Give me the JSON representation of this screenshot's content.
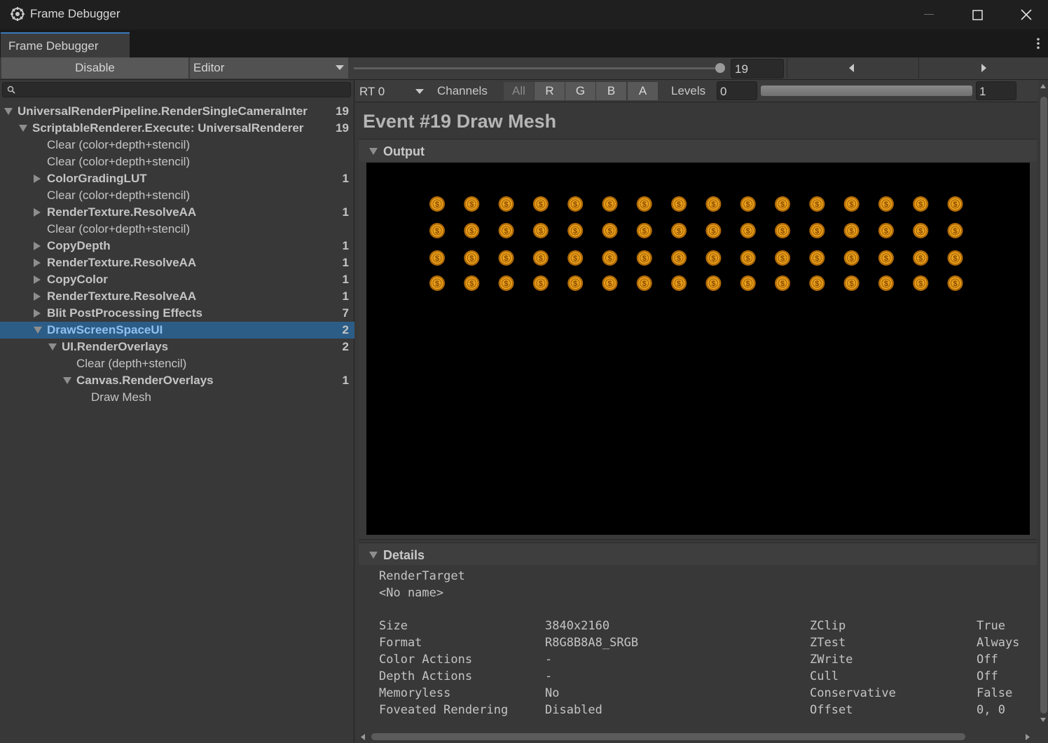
{
  "window": {
    "title": "Frame Debugger"
  },
  "tab": {
    "label": "Frame Debugger"
  },
  "toolbar": {
    "disable_label": "Disable",
    "target_label": "Editor",
    "event_index": "19",
    "event_slider_fraction": 1.0
  },
  "tree": {
    "rows": [
      {
        "label": "UniversalRenderPipeline.RenderSingleCameraInter",
        "count": "19",
        "depth": 0,
        "expand": "down",
        "bold": true
      },
      {
        "label": "ScriptableRenderer.Execute: UniversalRenderer",
        "count": "19",
        "depth": 1,
        "expand": "down",
        "bold": true
      },
      {
        "label": "Clear (color+depth+stencil)",
        "count": "",
        "depth": 2,
        "expand": "none",
        "bold": false
      },
      {
        "label": "Clear (color+depth+stencil)",
        "count": "",
        "depth": 2,
        "expand": "none",
        "bold": false
      },
      {
        "label": "ColorGradingLUT",
        "count": "1",
        "depth": 2,
        "expand": "right",
        "bold": true
      },
      {
        "label": "Clear (color+depth+stencil)",
        "count": "",
        "depth": 2,
        "expand": "none",
        "bold": false
      },
      {
        "label": "RenderTexture.ResolveAA",
        "count": "1",
        "depth": 2,
        "expand": "right",
        "bold": true
      },
      {
        "label": "Clear (color+depth+stencil)",
        "count": "",
        "depth": 2,
        "expand": "none",
        "bold": false
      },
      {
        "label": "CopyDepth",
        "count": "1",
        "depth": 2,
        "expand": "right",
        "bold": true
      },
      {
        "label": "RenderTexture.ResolveAA",
        "count": "1",
        "depth": 2,
        "expand": "right",
        "bold": true
      },
      {
        "label": "CopyColor",
        "count": "1",
        "depth": 2,
        "expand": "right",
        "bold": true
      },
      {
        "label": "RenderTexture.ResolveAA",
        "count": "1",
        "depth": 2,
        "expand": "right",
        "bold": true
      },
      {
        "label": "Blit PostProcessing Effects",
        "count": "7",
        "depth": 2,
        "expand": "right",
        "bold": true
      },
      {
        "label": "DrawScreenSpaceUI",
        "count": "2",
        "depth": 2,
        "expand": "down",
        "bold": true,
        "selected": true
      },
      {
        "label": "UI.RenderOverlays",
        "count": "2",
        "depth": 3,
        "expand": "down",
        "bold": true
      },
      {
        "label": "Clear (depth+stencil)",
        "count": "",
        "depth": 4,
        "expand": "none",
        "bold": false
      },
      {
        "label": "Canvas.RenderOverlays",
        "count": "1",
        "depth": 4,
        "expand": "down",
        "bold": true
      },
      {
        "label": "Draw Mesh",
        "count": "",
        "depth": 5,
        "expand": "none",
        "bold": false
      }
    ]
  },
  "render_target": {
    "selected": "RT 0",
    "channels_label": "Channels",
    "channels": [
      "All",
      "R",
      "G",
      "B",
      "A"
    ],
    "levels_label": "Levels",
    "levels_min": "0",
    "levels_max": "1"
  },
  "event": {
    "title": "Event #19 Draw Mesh"
  },
  "output": {
    "label": "Output",
    "coin_rows": 4,
    "coin_cols": 16,
    "coin_color": "#e8a01a"
  },
  "details": {
    "label": "Details",
    "render_target_label": "RenderTarget",
    "render_target_name": "<No name>",
    "left": [
      {
        "key": "Size",
        "value": "3840x2160"
      },
      {
        "key": "Format",
        "value": "R8G8B8A8_SRGB"
      },
      {
        "key": "Color Actions",
        "value": "-"
      },
      {
        "key": "Depth Actions",
        "value": "-"
      },
      {
        "key": "Memoryless",
        "value": "No"
      },
      {
        "key": "Foveated Rendering",
        "value": "Disabled"
      }
    ],
    "right": [
      {
        "key": "ZClip",
        "value": "True"
      },
      {
        "key": "ZTest",
        "value": "Always"
      },
      {
        "key": "ZWrite",
        "value": "Off"
      },
      {
        "key": "Cull",
        "value": "Off"
      },
      {
        "key": "Conservative",
        "value": "False"
      },
      {
        "key": "Offset",
        "value": "0, 0"
      }
    ]
  },
  "colors": {
    "selection": "#2c5d87",
    "accent": "#3a79bb"
  }
}
